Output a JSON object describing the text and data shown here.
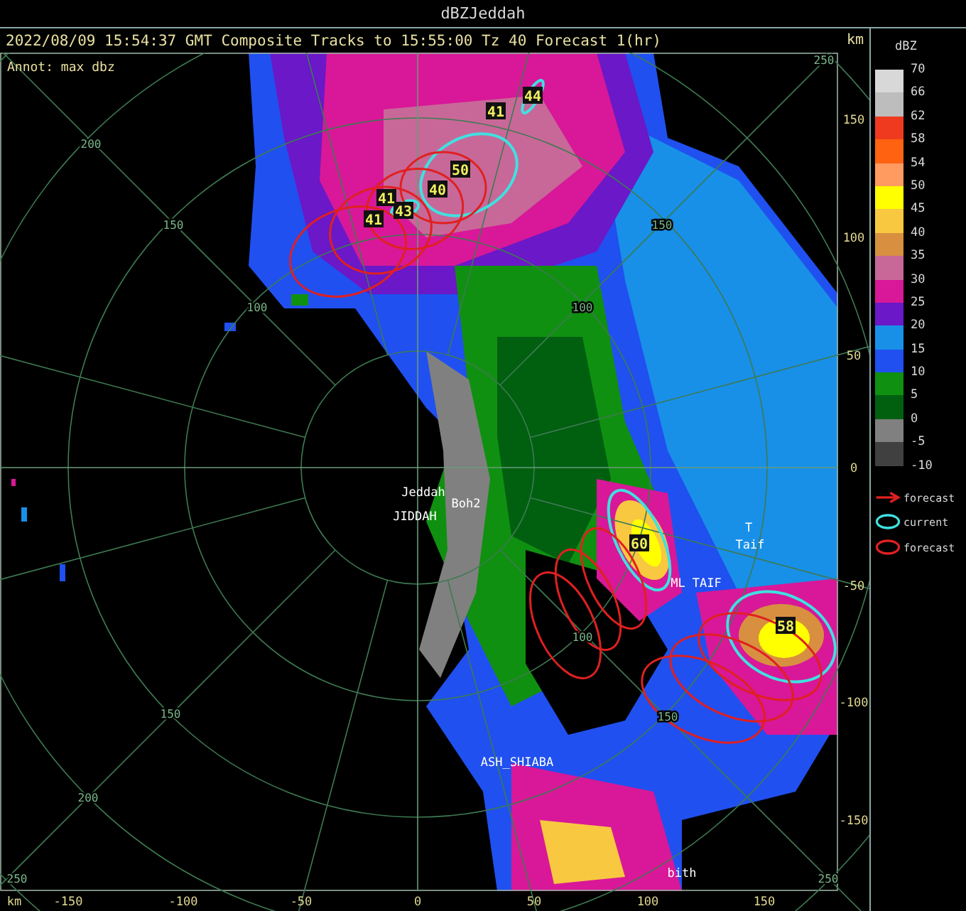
{
  "window": {
    "title": "dBZJeddah"
  },
  "header": {
    "text": "2022/08/09 15:54:37 GMT Composite Tracks to 15:55:00 Tz 40 Forecast 1(hr)",
    "unit": "km"
  },
  "map": {
    "annotation": "Annot: max dbz",
    "range_labels": [
      "250",
      "200",
      "150",
      "100",
      "150",
      "100",
      "100",
      "150",
      "200",
      "150",
      "250",
      "250"
    ],
    "places": [
      "Jeddah",
      "Boh2",
      "JIDDAH",
      "T",
      "Taif",
      "ML TAIF",
      "ASH_SHIABA",
      "bith"
    ],
    "cells": [
      "44",
      "41",
      "50",
      "40",
      "43",
      "41",
      "41",
      "60",
      "58"
    ],
    "x_axis": {
      "unit": "km",
      "ticks": [
        "-150",
        "-100",
        "-50",
        "0",
        "50",
        "100",
        "150"
      ]
    },
    "y_axis": {
      "ticks": [
        "150",
        "100",
        "50",
        "0",
        "-50",
        "-100",
        "-150"
      ]
    }
  },
  "legend": {
    "title": "dBZ",
    "scale": [
      {
        "label": "70",
        "color": "#d8d8d8"
      },
      {
        "label": "66",
        "color": "#bdbdbd"
      },
      {
        "label": "62",
        "color": "#f03a20"
      },
      {
        "label": "58",
        "color": "#ff6210"
      },
      {
        "label": "54",
        "color": "#ff9a60"
      },
      {
        "label": "50",
        "color": "#ffff00"
      },
      {
        "label": "45",
        "color": "#f8c840"
      },
      {
        "label": "40",
        "color": "#d89040"
      },
      {
        "label": "35",
        "color": "#c86898"
      },
      {
        "label": "30",
        "color": "#d81898"
      },
      {
        "label": "25",
        "color": "#6a18c8"
      },
      {
        "label": "20",
        "color": "#1890e8"
      },
      {
        "label": "15",
        "color": "#2050f0"
      },
      {
        "label": "10",
        "color": "#109010"
      },
      {
        "label": "5",
        "color": "#006010"
      },
      {
        "label": "0",
        "color": "#808080"
      },
      {
        "label": "-5",
        "color": "#404040"
      }
    ],
    "bottom_label": "-10",
    "symbols": [
      {
        "kind": "arrow",
        "label": "forecast",
        "color": "#e02020"
      },
      {
        "kind": "ellipse",
        "label": "current",
        "color": "#40e0e0"
      },
      {
        "kind": "ellipse",
        "label": "forecast",
        "color": "#e02020"
      }
    ]
  }
}
